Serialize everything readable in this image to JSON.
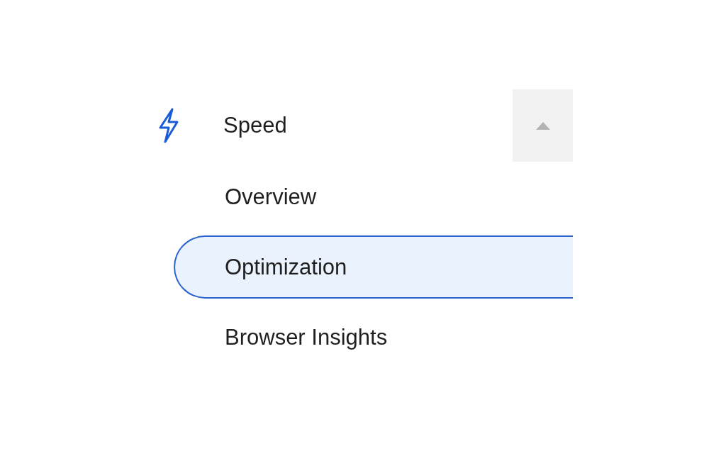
{
  "section": {
    "title": "Speed",
    "expanded": true,
    "items": [
      {
        "label": "Overview",
        "selected": false
      },
      {
        "label": "Optimization",
        "selected": true
      },
      {
        "label": "Browser Insights",
        "selected": false
      }
    ]
  }
}
